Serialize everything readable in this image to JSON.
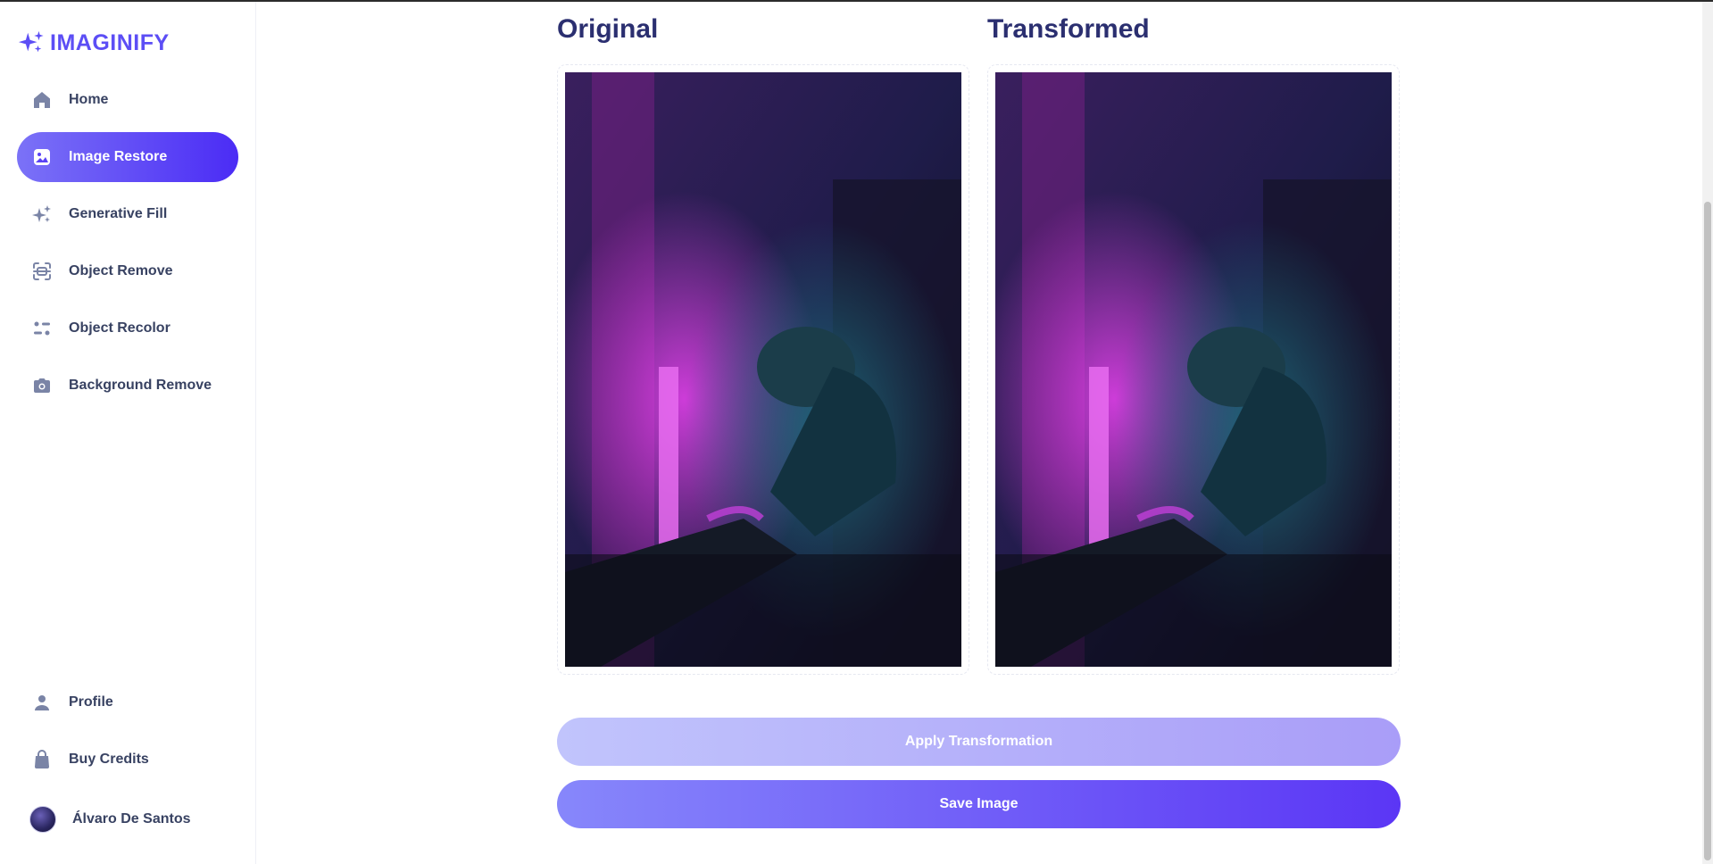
{
  "app": {
    "logo_text": "IMAGINIFY",
    "brand_color": "#5c4ef5"
  },
  "sidebar": {
    "items": [
      {
        "label": "Home",
        "icon": "home-icon"
      },
      {
        "label": "Image Restore",
        "icon": "image-icon",
        "active": true
      },
      {
        "label": "Generative Fill",
        "icon": "stars-icon"
      },
      {
        "label": "Object Remove",
        "icon": "scan-icon"
      },
      {
        "label": "Object Recolor",
        "icon": "filter-icon"
      },
      {
        "label": "Background Remove",
        "icon": "camera-icon"
      }
    ],
    "bottom_items": [
      {
        "label": "Profile",
        "icon": "user-icon"
      },
      {
        "label": "Buy Credits",
        "icon": "bag-icon"
      }
    ],
    "user": {
      "name": "Álvaro De Santos"
    }
  },
  "main": {
    "original_heading": "Original",
    "transformed_heading": "Transformed",
    "apply_label": "Apply Transformation",
    "save_label": "Save Image"
  },
  "colors": {
    "active_gradient_start": "#7b72f7",
    "active_gradient_end": "#4b2cf5",
    "heading": "#2b2f70",
    "nav_text": "#384262"
  }
}
